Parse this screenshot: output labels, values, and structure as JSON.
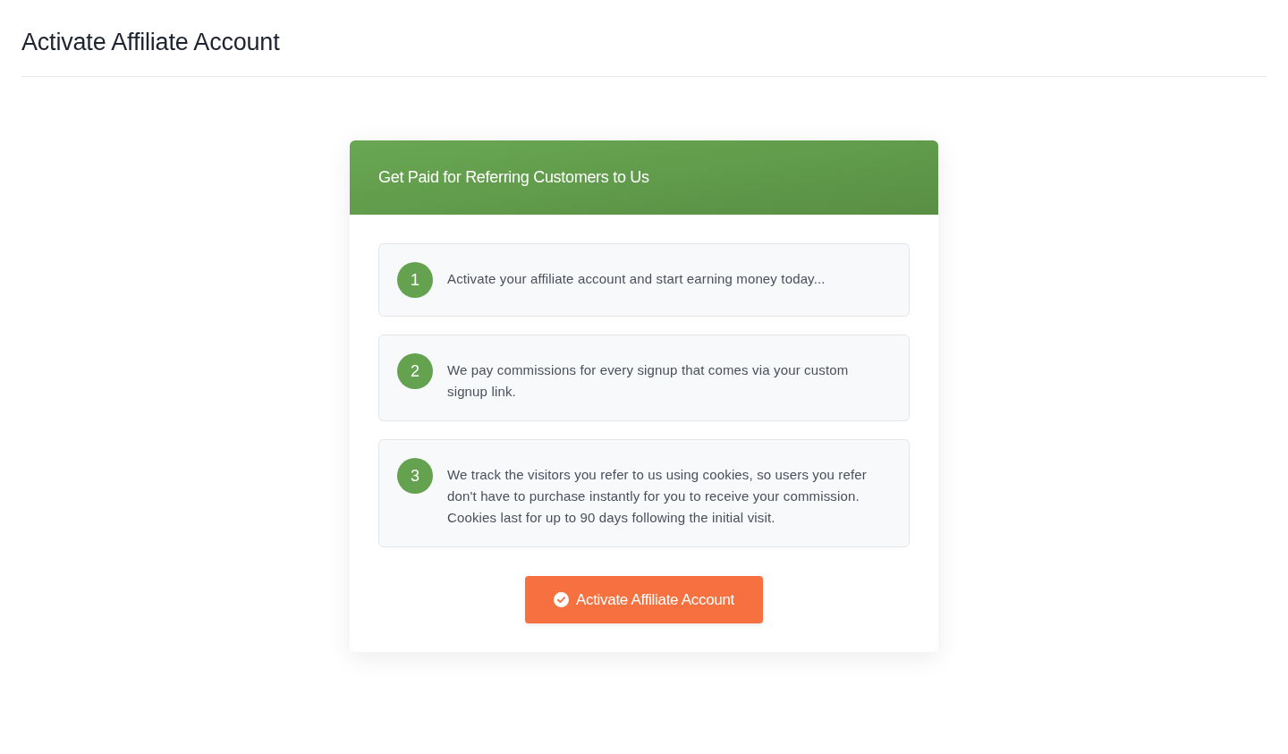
{
  "page": {
    "title": "Activate Affiliate Account"
  },
  "card": {
    "header": "Get Paid for Referring Customers to Us",
    "steps": [
      {
        "number": "1",
        "text": "Activate your affiliate account and start earning money today..."
      },
      {
        "number": "2",
        "text": "We pay commissions for every signup that comes via your custom signup link."
      },
      {
        "number": "3",
        "text": "We track the visitors you refer to us using cookies, so users you refer don't have to purchase instantly for you to receive your commission. Cookies last for up to 90 days following the initial visit."
      }
    ],
    "button": {
      "label": "Activate Affiliate Account"
    }
  }
}
